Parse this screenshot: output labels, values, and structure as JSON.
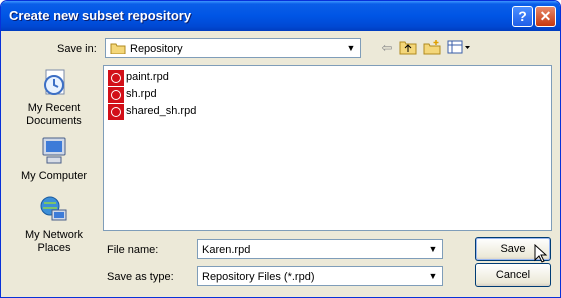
{
  "window": {
    "title": "Create new subset repository"
  },
  "titlebar": {
    "help_glyph": "?",
    "close_glyph": "✕"
  },
  "toolbar": {
    "save_in_label": "Save in:",
    "location": "Repository",
    "icons": [
      "back-arrow-icon",
      "up-folder-icon",
      "new-folder-icon",
      "view-menu-icon"
    ]
  },
  "places": [
    {
      "label": "My Recent Documents",
      "line1": "My Recent",
      "line2": "Documents"
    },
    {
      "label": "My Computer",
      "line1": "My Computer",
      "line2": ""
    },
    {
      "label": "My Network Places",
      "line1": "My Network",
      "line2": "Places"
    }
  ],
  "files": [
    "paint.rpd",
    "sh.rpd",
    "shared_sh.rpd"
  ],
  "form": {
    "file_name_label": "File name:",
    "file_name_value": "Karen.rpd",
    "save_as_type_label": "Save as type:",
    "save_as_type_value": "Repository Files (*.rpd)"
  },
  "buttons": {
    "save": "Save",
    "cancel": "Cancel"
  }
}
